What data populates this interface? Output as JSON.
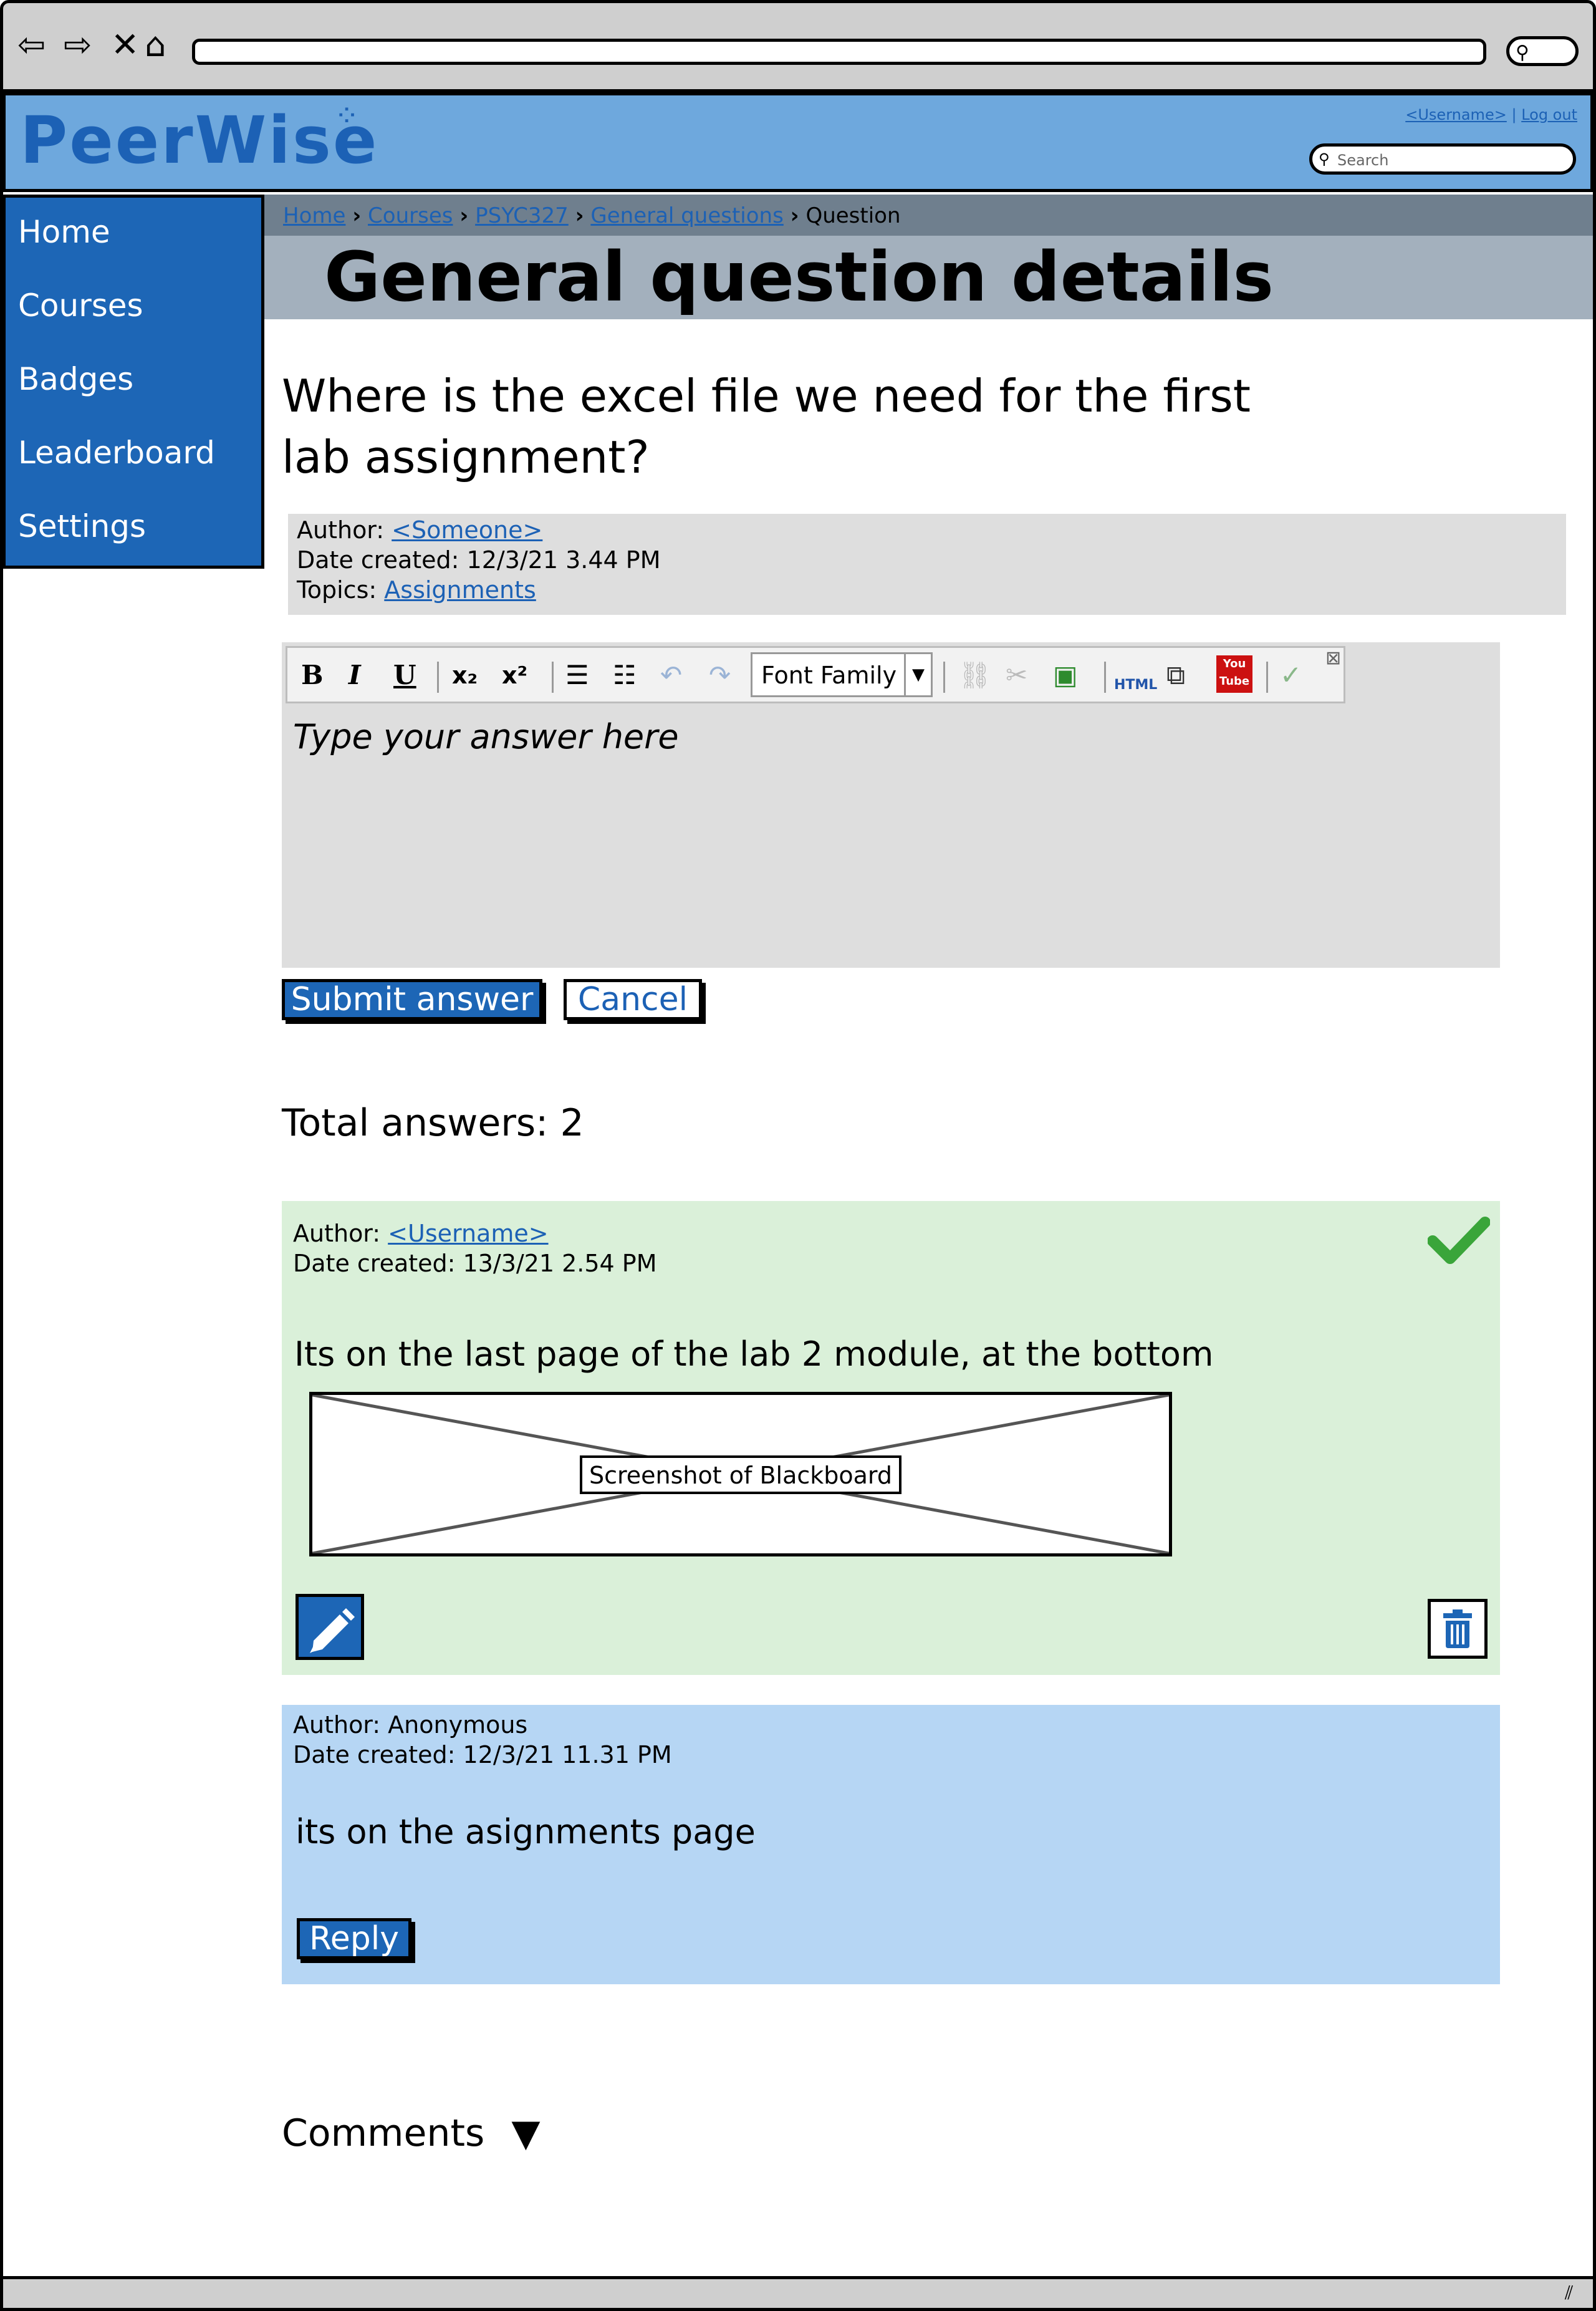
{
  "brand": {
    "name": "PeerWise",
    "accent": "#1d66b6",
    "header_bg": "#6ea8dd"
  },
  "header": {
    "username_link": "<Username>",
    "separator": "|",
    "logout_link": "Log out",
    "search_placeholder": "Search"
  },
  "sidebar": {
    "items": [
      {
        "label": "Home"
      },
      {
        "label": "Courses"
      },
      {
        "label": "Badges"
      },
      {
        "label": "Leaderboard"
      },
      {
        "label": "Settings"
      }
    ]
  },
  "breadcrumb": {
    "items": [
      "Home",
      "Courses",
      "PSYC327",
      "General questions"
    ],
    "current": "Question",
    "separator": "›"
  },
  "page": {
    "title": "General question details"
  },
  "question": {
    "text": "Where is the excel file we need for the first lab assignment?",
    "author_label": "Author:",
    "author": "<Someone>",
    "date_label": "Date created:",
    "date": "12/3/21 3.44 PM",
    "topics_label": "Topics:",
    "topic": "Assignments"
  },
  "editor": {
    "font_family_label": "Font Family",
    "placeholder": "Type your answer here",
    "toolbar_icons": [
      "bold-icon",
      "italic-icon",
      "underline-icon",
      "subscript-icon",
      "superscript-icon",
      "bullet-list-icon",
      "numbered-list-icon",
      "undo-icon",
      "redo-icon",
      "link-icon",
      "unlink-icon",
      "image-icon",
      "html-icon",
      "media-icon",
      "youtube-icon",
      "spellcheck-icon"
    ],
    "bold": "B",
    "italic": "I",
    "underline": "U",
    "subscript": "x₂",
    "superscript": "x²",
    "html": "HTML",
    "youtube": "You Tube"
  },
  "actions": {
    "submit": "Submit answer",
    "cancel": "Cancel"
  },
  "answers_summary": {
    "label": "Total answers:",
    "count": "2"
  },
  "answers": [
    {
      "author_label": "Author:",
      "author": "<Username>",
      "date_label": "Date created:",
      "date": "13/3/21 2.54 PM",
      "text": "Its on the last page of the lab 2 module, at the bottom",
      "image_label": "Screenshot of Blackboard",
      "accepted": true,
      "bg": "#daf0d9"
    },
    {
      "author_label": "Author:",
      "author": "Anonymous",
      "date_label": "Date created:",
      "date": "12/3/21 11.31 PM",
      "text": "its on the asignments page",
      "reply_label": "Reply",
      "bg": "#b6d6f4"
    }
  ],
  "comments": {
    "label": "Comments",
    "toggle_icon": "▼"
  }
}
